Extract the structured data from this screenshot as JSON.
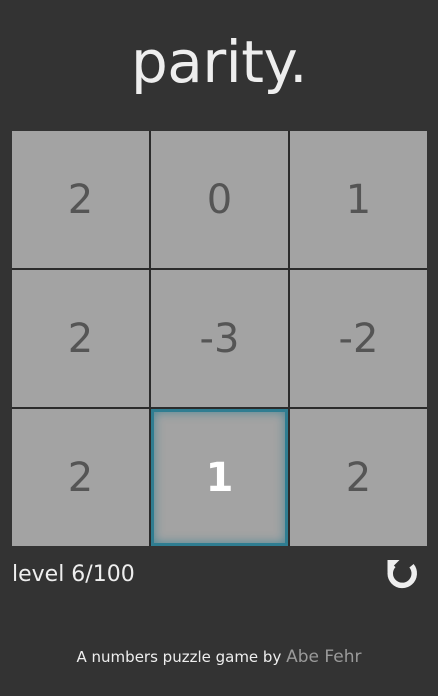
{
  "header": {
    "title": "parity."
  },
  "board": {
    "rows": 3,
    "cols": 3,
    "cells": [
      {
        "value": "2",
        "selected": false
      },
      {
        "value": "0",
        "selected": false
      },
      {
        "value": "1",
        "selected": false
      },
      {
        "value": "2",
        "selected": false
      },
      {
        "value": "-3",
        "selected": false
      },
      {
        "value": "-2",
        "selected": false
      },
      {
        "value": "2",
        "selected": false
      },
      {
        "value": "1",
        "selected": true
      },
      {
        "value": "2",
        "selected": false
      }
    ]
  },
  "status": {
    "level_text": "level 6/100",
    "reset_icon": "restart-icon"
  },
  "footer": {
    "tagline": "A numbers puzzle game by",
    "author": "Abe Fehr"
  },
  "colors": {
    "background": "#333333",
    "tile": "#a3a3a3",
    "tile_text": "#555555",
    "selected_border": "#2f7d91",
    "selected_text": "#ffffff",
    "author_link": "#9a9a9a"
  }
}
